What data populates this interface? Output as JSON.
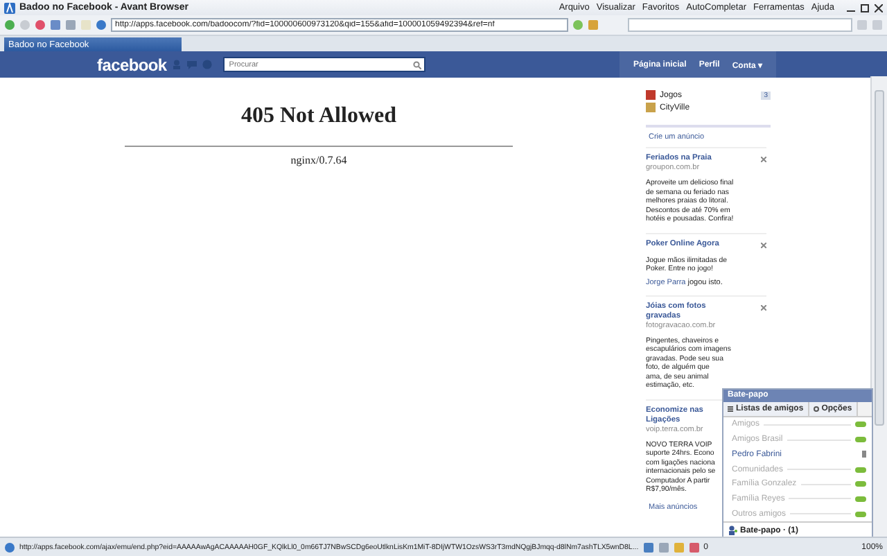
{
  "window": {
    "title": "Badoo no Facebook - Avant Browser"
  },
  "menu": [
    "Arquivo",
    "Visualizar",
    "Favoritos",
    "AutoCompletar",
    "Ferramentas",
    "Ajuda"
  ],
  "address": {
    "value": "http://apps.facebook.com/badoocom/?fid=100000600973120&qid=155&afid=100001059492394&ref=nf"
  },
  "tabs": [
    {
      "label": "Badoo no Facebook",
      "selected": true
    }
  ],
  "header": {
    "logo": "facebook",
    "search": {
      "placeholder": "Procurar"
    },
    "links": [
      "Página inicial",
      "Perfil",
      "Conta ▾"
    ]
  },
  "main": {
    "title": "405 Not Allowed",
    "server": "nginx/0.7.64"
  },
  "apps": [
    {
      "name": "Jogos",
      "count": "3"
    },
    {
      "name": "CityVille"
    }
  ],
  "ads_header": "Crie um anúncio",
  "ads": [
    {
      "title": "Feriados na Praia",
      "url": "groupon.com.br",
      "lines": [
        "Aproveite um delicioso final",
        "de semana ou feriado nas",
        "melhores praias do litoral.",
        "Descontos de até 70% em",
        "hotéis e pousadas. Confira!"
      ]
    },
    {
      "title": "Poker Online Agora",
      "lines": [
        "Jogue mãos ilimitadas de",
        "Poker. Entre no jogo!"
      ],
      "social": {
        "name": "Jorge Parra",
        "text": "jogou isto."
      }
    },
    {
      "title": "Jóias com fotos gravadas",
      "url": "fotogravacao.com.br",
      "lines": [
        "Pingentes, chaveiros e",
        "escapulários com imagens",
        "gravadas. Pode seu sua",
        "foto, de alguém que",
        "ama, de seu animal",
        "estimação, etc."
      ]
    },
    {
      "title": "Economize nas Ligações",
      "url": "voip.terra.com.br",
      "lines": [
        "NOVO TERRA VOIP",
        "suporte 24hrs. Econo",
        "com ligações naciona",
        "internacionais pelo se",
        "Computador A partir",
        "R$7,90/mês."
      ]
    }
  ],
  "more_ads": "Mais anúncios",
  "chat": {
    "title": "Bate-papo",
    "tabs": [
      "Listas de amigos",
      "Opções"
    ],
    "items": [
      {
        "kind": "group",
        "name": "Amigos",
        "on": true
      },
      {
        "kind": "group",
        "name": "Amigos Brasil",
        "on": true
      },
      {
        "kind": "friend",
        "name": "Pedro Fabrini"
      },
      {
        "kind": "group",
        "name": "Comunidades",
        "on": true
      },
      {
        "kind": "group",
        "name": "Família Gonzalez",
        "on": true
      },
      {
        "kind": "group",
        "name": "Família Reyes",
        "on": true
      },
      {
        "kind": "group",
        "name": "Outros amigos",
        "on": true
      }
    ],
    "footer": "Bate-papo · (1)"
  },
  "status_bar": {
    "url": "http://apps.facebook.com/ajax/emu/end.php?eid=AAAAAwAgACAAAAAH0GF_KQlkLl0_0m66TJ7NBwSCDg6eoUtlknLisKm1MiT-8DIjWTW1OzsWS3rT3mdNQgjBJmqq-d8lNm7ashTLX5wnD8L...",
    "count": "0",
    "zoom": "100%"
  }
}
